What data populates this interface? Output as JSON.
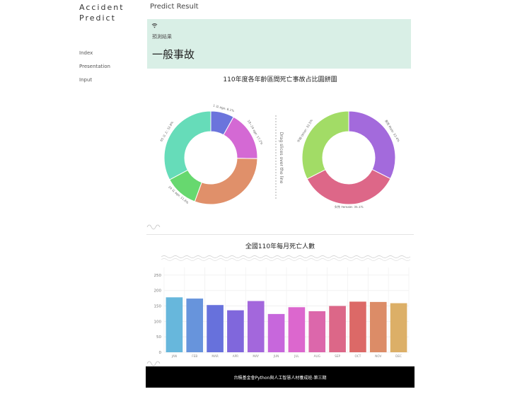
{
  "brand": {
    "line1": "Accident",
    "line2": "Predict"
  },
  "nav": {
    "items": [
      "Index",
      "Presentation",
      "Input"
    ]
  },
  "page": {
    "title": "Predict Result"
  },
  "result": {
    "icon": "wifi-icon",
    "label": "預測結果",
    "value": "一般事故"
  },
  "donut_section": {
    "title": "110年度各年齡區間死亡事故占比圓餅圖",
    "drag_hint": "Drag slices over the line"
  },
  "bar_section": {
    "title": "全國110年每月死亡人數"
  },
  "footer": {
    "text": "台積基金會Python與人工智慧人材養成班-第三期"
  },
  "colors": {
    "result_bg": "#d9efe6",
    "footer_bg": "#000000"
  },
  "chart_data": [
    {
      "type": "pie",
      "variant": "donut",
      "slices": [
        {
          "label": "1 以 age: 8.1%",
          "value": 8.1,
          "color": "#6b74dc"
        },
        {
          "label": "18~24 age: 17.2%",
          "value": 17.2,
          "color": "#d469d4"
        },
        {
          "label": "",
          "value": 30.3,
          "color": "#e0906a"
        },
        {
          "label": "24 以 age: 11.6%",
          "value": 11.6,
          "color": "#67d86f"
        },
        {
          "label": "65 以 上: 32.8%",
          "value": 32.8,
          "color": "#66dcb9"
        }
      ]
    },
    {
      "type": "pie",
      "variant": "donut",
      "slices": [
        {
          "label": "男性 Male: 32.4%",
          "value": 32.4,
          "color": "#a36adc"
        },
        {
          "label": "女性 Female: 35.1%",
          "value": 35.1,
          "color": "#dd6788"
        },
        {
          "label": "不明 Other: 32.5%",
          "value": 32.5,
          "color": "#a2dc66"
        }
      ]
    },
    {
      "type": "bar",
      "categories": [
        "JAN",
        "FEB",
        "MAR",
        "APR",
        "MAY",
        "JUN",
        "JUL",
        "AUG",
        "SEP",
        "OCT",
        "NOV",
        "DEC"
      ],
      "values": [
        178,
        174,
        153,
        136,
        166,
        124,
        146,
        133,
        150,
        164,
        163,
        159
      ],
      "colors": [
        "#67b7dc",
        "#6794dc",
        "#6771dc",
        "#8067dc",
        "#a367dc",
        "#c767dc",
        "#dc67ce",
        "#dc67ab",
        "#dc6788",
        "#dc6967",
        "#dc8c67",
        "#dcaf67"
      ],
      "yticks": [
        0,
        50,
        100,
        150,
        200,
        250
      ],
      "ylim": [
        0,
        275
      ]
    }
  ]
}
